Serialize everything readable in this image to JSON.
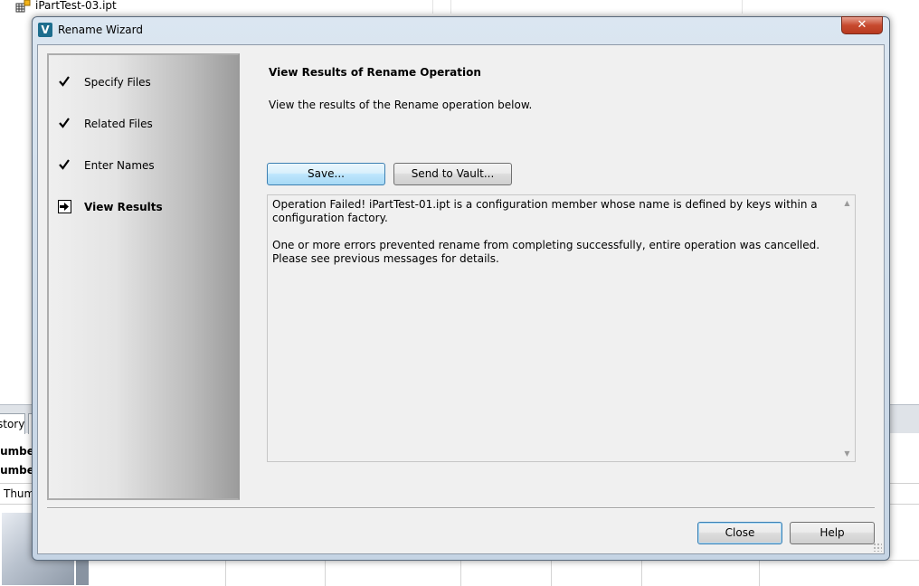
{
  "background": {
    "file_name": "iPartTest-03.ipt",
    "tab_label": "story",
    "row1_label": "lumbe",
    "row2_label": "lumbe",
    "thumb_label": "Thum"
  },
  "dialog": {
    "title": "Rename Wizard",
    "app_icon_letter": "V",
    "close_glyph": "✕",
    "steps": [
      {
        "label": "Specify Files",
        "state": "done",
        "icon": "checkmark-icon"
      },
      {
        "label": "Related Files",
        "state": "done",
        "icon": "checkmark-icon"
      },
      {
        "label": "Enter Names",
        "state": "done",
        "icon": "checkmark-icon"
      },
      {
        "label": "View Results",
        "state": "current",
        "icon": "arrow-right-icon"
      }
    ],
    "heading": "View Results of Rename Operation",
    "subtext": "View the results of the Rename operation below.",
    "buttons": {
      "save": "Save...",
      "send_to_vault": "Send to Vault...",
      "close": "Close",
      "help": "Help"
    },
    "results": {
      "message1": "Operation Failed! iPartTest-01.ipt is a configuration member whose name is defined by keys within a configuration factory.",
      "message2": "One or more errors prevented rename from completing successfully, entire operation was cancelled. Please see previous messages for details."
    }
  },
  "colors": {
    "selected_button": "#bee6fd",
    "close_button": "#c74a2f",
    "title_bar": "#dbe6f1"
  }
}
